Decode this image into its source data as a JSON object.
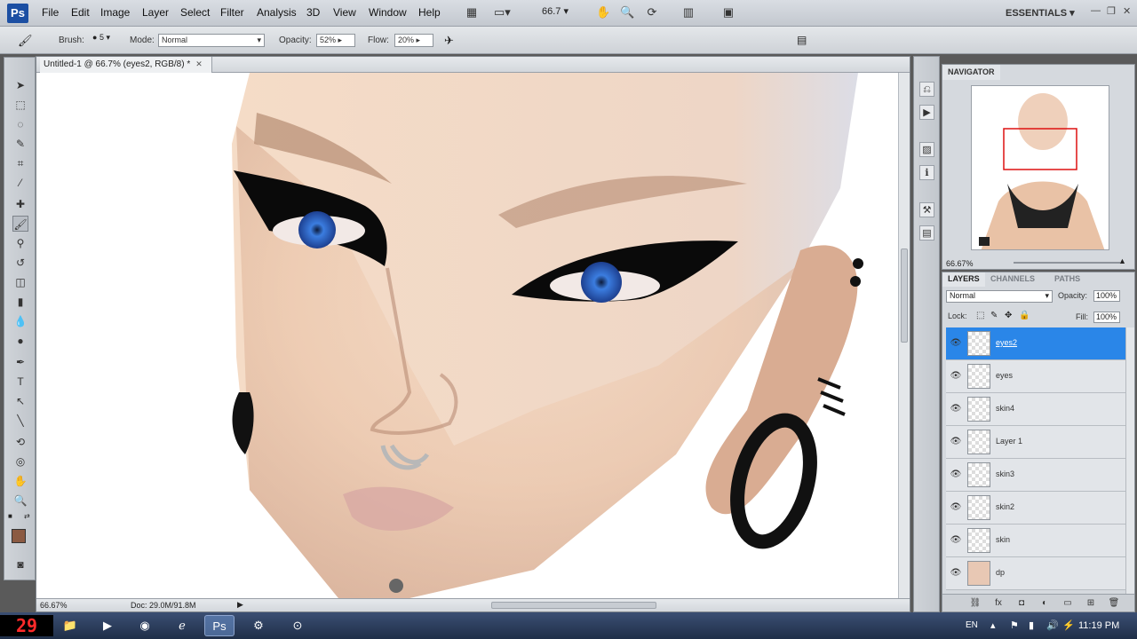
{
  "menubar": {
    "logo": "Ps",
    "items": [
      "File",
      "Edit",
      "Image",
      "Layer",
      "Select",
      "Filter",
      "Analysis",
      "3D",
      "View",
      "Window",
      "Help"
    ],
    "zoom": "66.7",
    "workspace": "ESSENTIALS",
    "icons": [
      "bridge-icon",
      "arrange-icon",
      "hand-icon",
      "zoom-icon",
      "rotate-view-icon",
      "arrange-documents-icon",
      "screen-mode-icon"
    ]
  },
  "options": {
    "brush_label": "Brush:",
    "brush_size": "5",
    "mode_label": "Mode:",
    "mode_value": "Normal",
    "opacity_label": "Opacity:",
    "opacity_value": "52%",
    "flow_label": "Flow:",
    "flow_value": "20%"
  },
  "document": {
    "tab_title": "Untitled-1 @ 66.7% (eyes2, RGB/8) *",
    "status_zoom": "66.67%",
    "status_doc": "Doc: 29.0M/91.8M"
  },
  "navigator": {
    "tab": "NAVIGATOR",
    "zoom": "66.67%"
  },
  "layers": {
    "tabs": [
      "LAYERS",
      "CHANNELS",
      "PATHS"
    ],
    "blend_mode": "Normal",
    "opacity_label": "Opacity:",
    "opacity_value": "100%",
    "lock_label": "Lock:",
    "fill_label": "Fill:",
    "fill_value": "100%",
    "items": [
      {
        "name": "eyes2",
        "selected": true
      },
      {
        "name": "eyes",
        "selected": false
      },
      {
        "name": "skin4",
        "selected": false
      },
      {
        "name": "Layer 1",
        "selected": false
      },
      {
        "name": "skin3",
        "selected": false
      },
      {
        "name": "skin2",
        "selected": false
      },
      {
        "name": "skin",
        "selected": false
      },
      {
        "name": "dp",
        "selected": false
      }
    ]
  },
  "taskbar": {
    "counter": "29",
    "language": "EN",
    "clock": "11:19 PM"
  },
  "colors": {
    "foreground": "#8b5a42",
    "selection": "#2a86e8"
  }
}
